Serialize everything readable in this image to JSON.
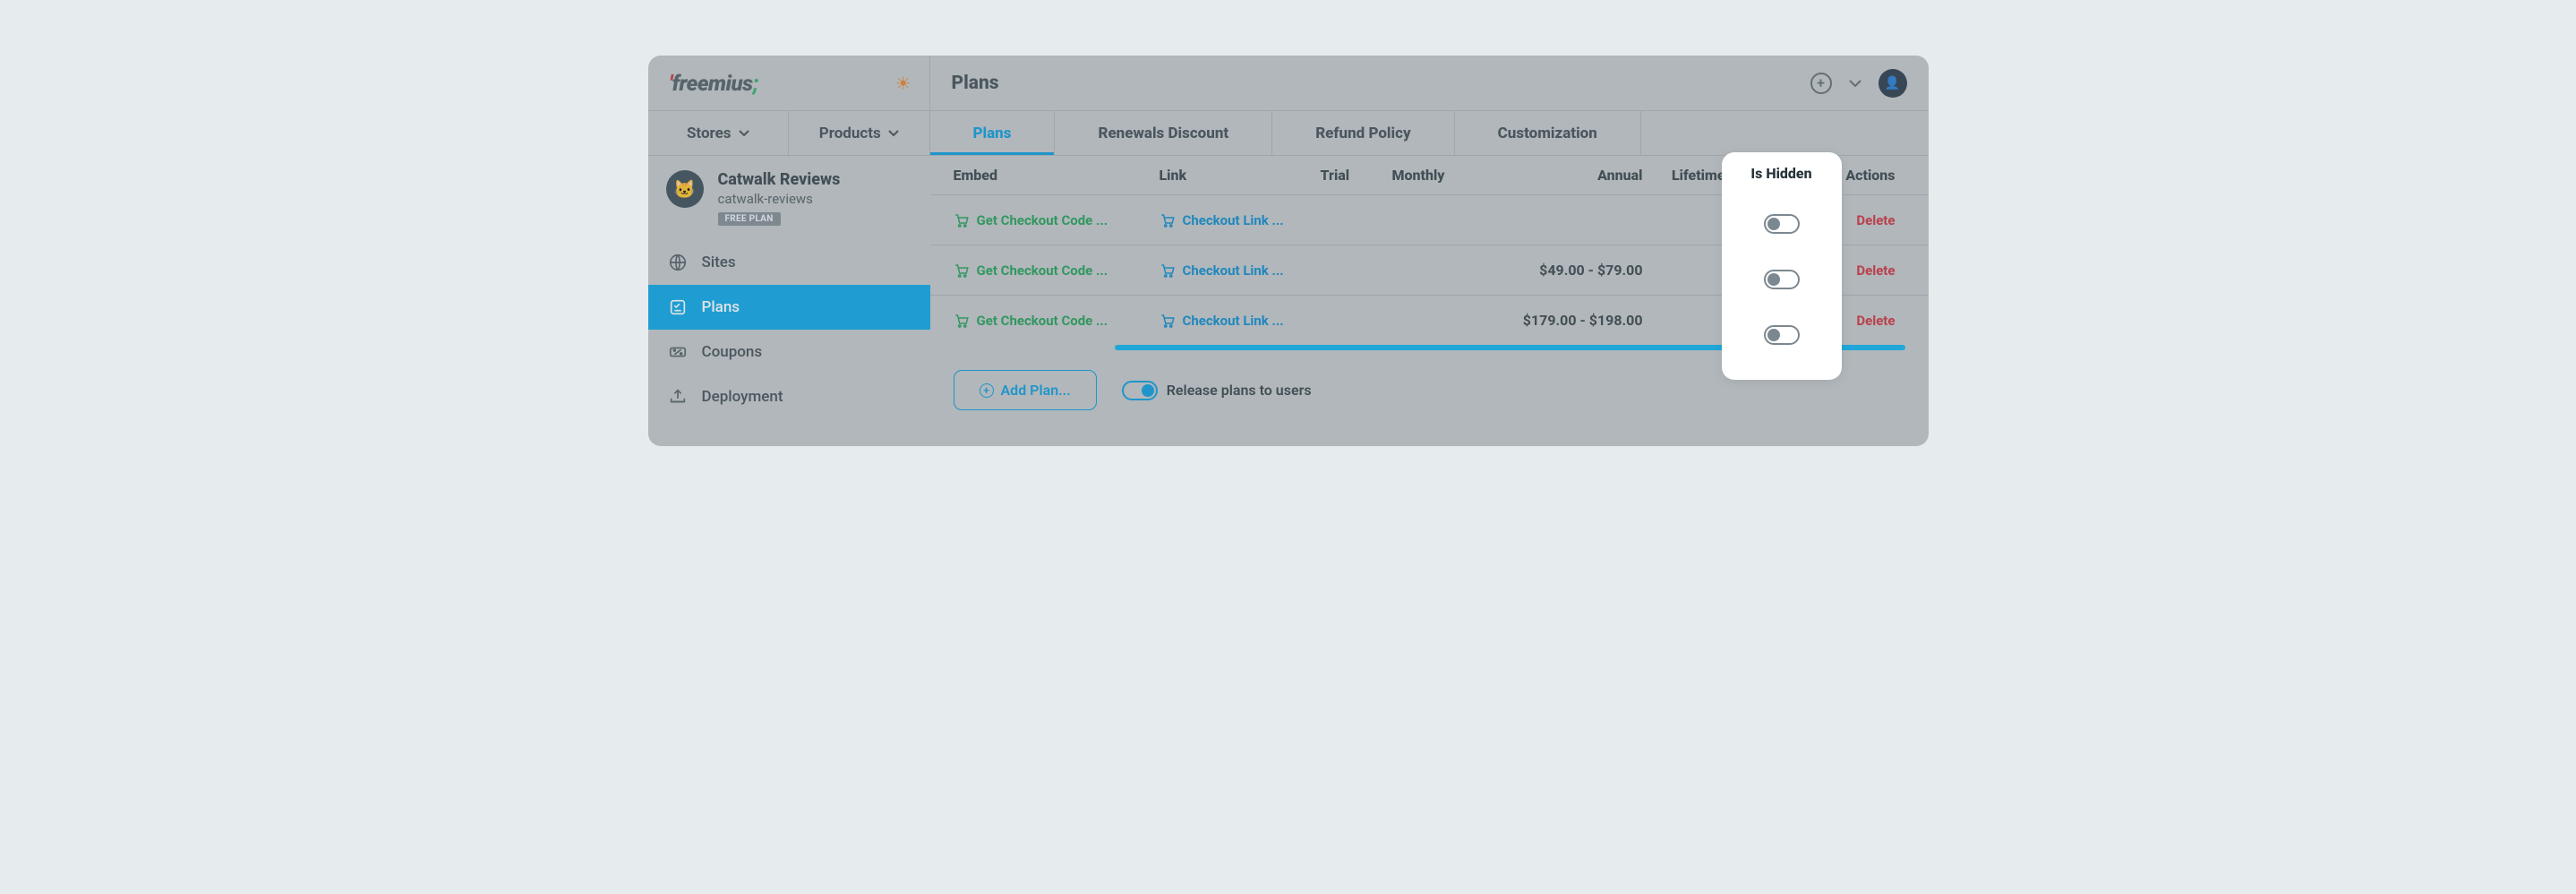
{
  "header": {
    "title": "Plans"
  },
  "logo": {
    "text": "freemius"
  },
  "subnav": {
    "stores": "Stores",
    "products": "Products"
  },
  "tabs": [
    {
      "id": "plans",
      "label": "Plans",
      "active": true
    },
    {
      "id": "renewals",
      "label": "Renewals Discount",
      "active": false
    },
    {
      "id": "refund",
      "label": "Refund Policy",
      "active": false
    },
    {
      "id": "custom",
      "label": "Customization",
      "active": false
    }
  ],
  "product": {
    "name": "Catwalk Reviews",
    "slug": "catwalk-reviews",
    "badge": "FREE PLAN"
  },
  "sidebar": [
    {
      "id": "sites",
      "label": "Sites",
      "active": false
    },
    {
      "id": "plans",
      "label": "Plans",
      "active": true
    },
    {
      "id": "coupons",
      "label": "Coupons",
      "active": false
    },
    {
      "id": "deployment",
      "label": "Deployment",
      "active": false
    }
  ],
  "columns": {
    "embed": "Embed",
    "link": "Link",
    "trial": "Trial",
    "monthly": "Monthly",
    "annual": "Annual",
    "lifetime": "Lifetime",
    "hidden": "Is Hidden",
    "actions": "Actions"
  },
  "rows": [
    {
      "embed": "Get Checkout Code ...",
      "link": "Checkout Link ...",
      "annual": "",
      "delete": "Delete"
    },
    {
      "embed": "Get Checkout Code ...",
      "link": "Checkout Link ...",
      "annual": "$49.00 - $79.00",
      "delete": "Delete"
    },
    {
      "embed": "Get Checkout Code ...",
      "link": "Checkout Link ...",
      "annual": "$179.00 - $198.00",
      "delete": "Delete"
    }
  ],
  "footer": {
    "add_plan": "Add Plan...",
    "release": "Release plans to users"
  }
}
